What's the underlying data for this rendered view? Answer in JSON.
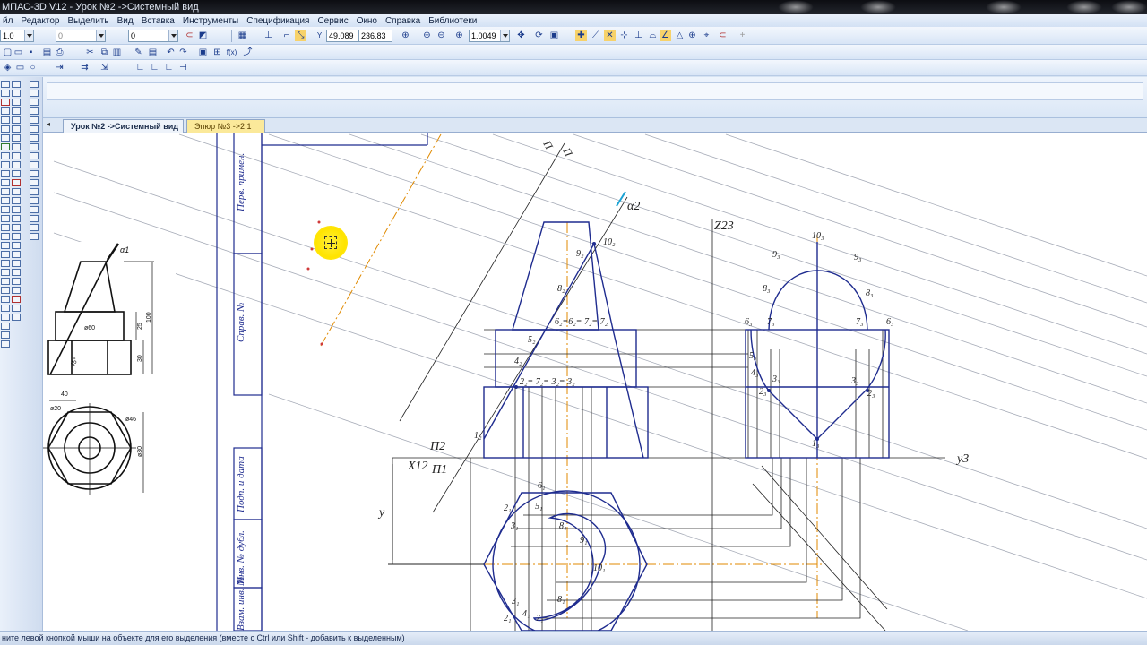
{
  "window": {
    "title": "МПАС-3D V12 - Урок №2 ->Системный вид"
  },
  "menu": [
    "йл",
    "Редактор",
    "Выделить",
    "Вид",
    "Вставка",
    "Инструменты",
    "Спецификация",
    "Сервис",
    "Окно",
    "Справка",
    "Библиотеки"
  ],
  "toolbar": {
    "line_scale": "1.0",
    "layer": "0",
    "style": "0",
    "coord_x": "49.089",
    "coord_y": "236.83",
    "zoom": "1.0049"
  },
  "tabs": [
    {
      "label": "Урок №2 ->Системный вид",
      "active": true
    },
    {
      "label": "Эпюр №3 ->2 1",
      "active": false
    }
  ],
  "drawing": {
    "stamp_labels": [
      "Перв. примен.",
      "Справ. №",
      "Подп. и дата",
      "Инв. № дубл.",
      "Взам. инв. №"
    ],
    "axis_labels": {
      "z23": "Z23",
      "y3": "y3",
      "x12": "X12",
      "pi2": "П2",
      "pi1": "П1",
      "alpha2": "α2",
      "y": "y"
    },
    "ref_labels": {
      "alpha1": "α1",
      "d60": "ø60",
      "d20": "ø20",
      "d46": "ø46",
      "d30": "ø30",
      "w40": "40",
      "h25": "25",
      "h100": "100",
      "h30": "30",
      "a45": "45°"
    },
    "front_points": [
      "1₂",
      "2₂≡ 7₂≡ 3₂≡ 3₂",
      "4₂",
      "5₂",
      "6₂≡6₂≡ 7₂≡ 7₂",
      "8₂",
      "9₂",
      "10₂"
    ],
    "side_points": [
      "10₃",
      "9₃",
      "9₃",
      "8₃",
      "8₃",
      "6₃",
      "6₃",
      "7₃",
      "7₃",
      "5₃",
      "4₃",
      "2₃",
      "2₃",
      "3₃",
      "3₃",
      "1₃"
    ],
    "top_points": [
      "6₁",
      "2₁",
      "3₁",
      "5₁",
      "9₁",
      "10₁",
      "8₁",
      "8₁",
      "3₁",
      "2₁",
      "7₁",
      "4₁"
    ]
  },
  "status": {
    "text": "ните левой кнопкой мыши на объекте для его выделения (вместе с Ctrl или Shift - добавить к выделенным)"
  },
  "colors": {
    "accent": "#1f2c8f",
    "axis": "#e08a00",
    "hatch": "#9aa0ad",
    "highlight": "#ffe400"
  }
}
